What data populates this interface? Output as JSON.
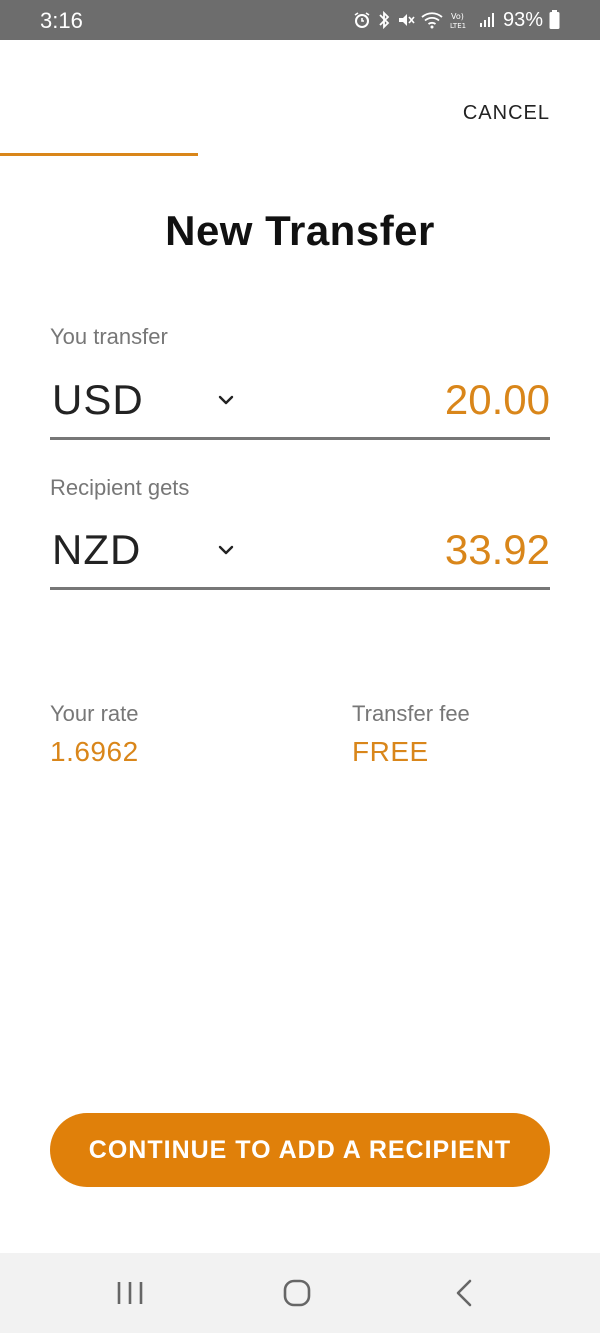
{
  "status_bar": {
    "time": "3:16",
    "battery": "93%",
    "icons": [
      "alarm-icon",
      "bluetooth-icon",
      "mute-icon",
      "wifi-icon",
      "volte-icon",
      "signal-icon",
      "battery-icon"
    ]
  },
  "header": {
    "cancel_label": "CANCEL",
    "progress": 0.33,
    "title": "New Transfer"
  },
  "transfer": {
    "send_label": "You transfer",
    "send_currency": "USD",
    "send_amount": "20.00",
    "receive_label": "Recipient gets",
    "receive_currency": "NZD",
    "receive_amount": "33.92"
  },
  "info": {
    "rate_label": "Your rate",
    "rate_value": "1.6962",
    "fee_label": "Transfer fee",
    "fee_value": "FREE"
  },
  "actions": {
    "continue_label": "CONTINUE TO ADD A RECIPIENT"
  },
  "nav_bar": {
    "buttons": [
      "recent-apps-icon",
      "home-icon",
      "back-icon"
    ]
  },
  "colors": {
    "accent": "#d9861a",
    "button": "#e0800a",
    "status_bar": "#6d6d6d"
  }
}
